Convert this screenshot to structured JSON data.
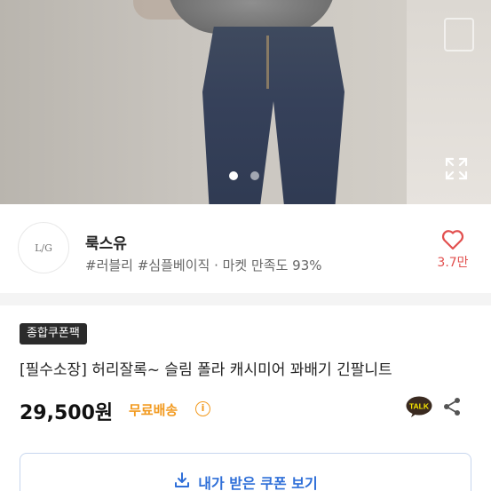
{
  "gallery": {
    "dots": [
      true,
      false
    ],
    "expand_icon": "expand-icon"
  },
  "store": {
    "logo_text": "L/G",
    "name": "룩스유",
    "tags": "#러블리 #심플베이직 · 마켓 만족도 93%",
    "like_icon": "heart-icon",
    "like_count": "3.7만"
  },
  "product": {
    "badge": "종합쿠폰팩",
    "title": "[필수소장] 허리잘록~ 슬림 폴라 캐시미어 꽈배기 긴팔니트",
    "price": "29,500원",
    "shipping": "무료배송",
    "talk_label": "TALK"
  },
  "coupon": {
    "button_label": "내가 받은 쿠폰 보기",
    "icon": "download-icon"
  },
  "colors": {
    "accent_orange": "#f29a1f",
    "like_red": "#e2504f",
    "coupon_blue": "#2f6fd8",
    "badge_dark": "#2b2b2b"
  }
}
